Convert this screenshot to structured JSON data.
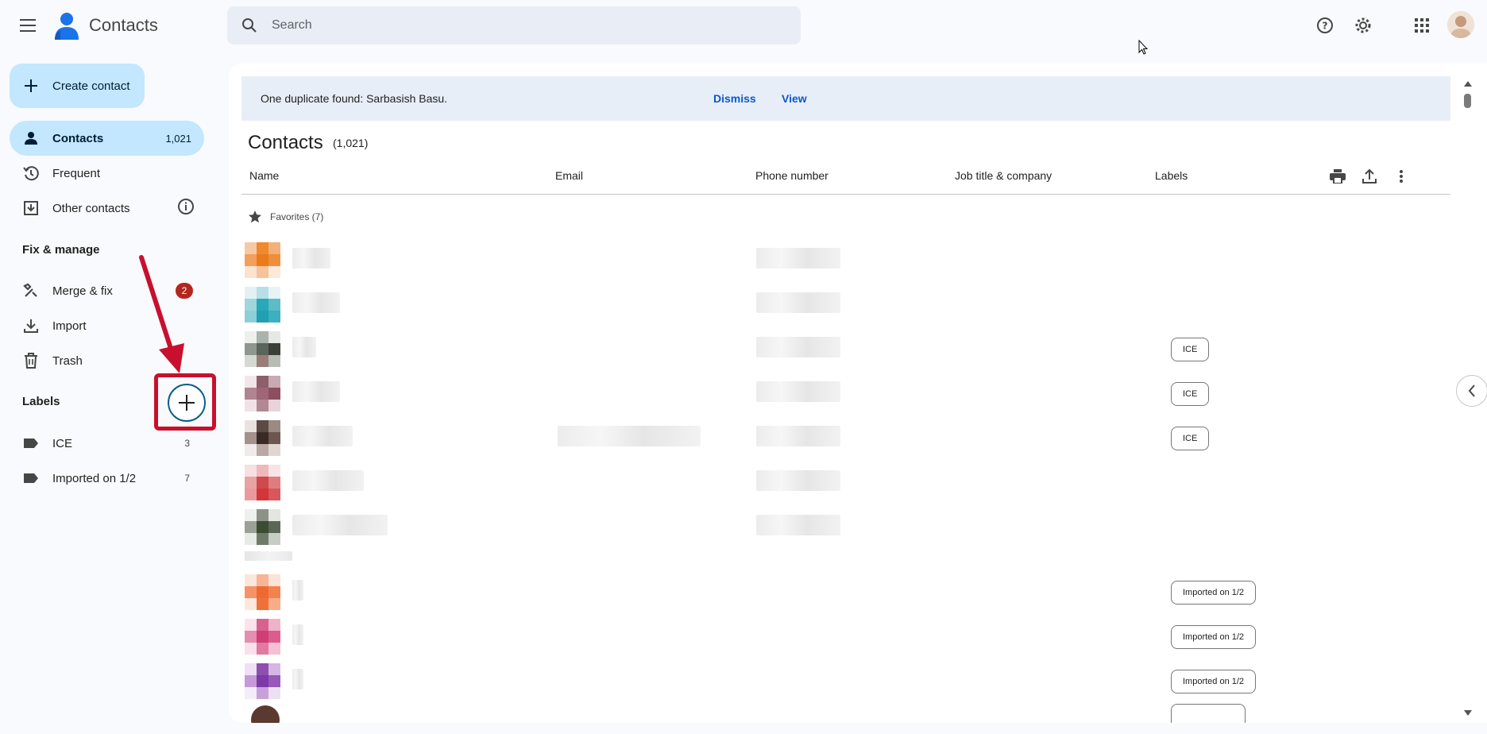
{
  "app": {
    "title": "Contacts"
  },
  "search": {
    "placeholder": "Search"
  },
  "sidebar": {
    "create_label": "Create contact",
    "contacts": {
      "label": "Contacts",
      "count": "1,021"
    },
    "frequent": {
      "label": "Frequent"
    },
    "other": {
      "label": "Other contacts"
    },
    "fix_manage_title": "Fix & manage",
    "merge": {
      "label": "Merge & fix",
      "badge": "2"
    },
    "import": {
      "label": "Import"
    },
    "trash": {
      "label": "Trash"
    },
    "labels_title": "Labels",
    "labels": [
      {
        "label": "ICE",
        "count": "3"
      },
      {
        "label": "Imported on 1/2",
        "count": "7"
      }
    ]
  },
  "banner": {
    "text": "One duplicate found: Sarbasish Basu.",
    "dismiss": "Dismiss",
    "view": "View"
  },
  "main": {
    "title": "Contacts",
    "count": "(1,021)",
    "columns": {
      "name": "Name",
      "email": "Email",
      "phone": "Phone number",
      "job": "Job title & company",
      "labels": "Labels"
    },
    "favorites": "Favorites (7)",
    "rows": [
      {
        "chip": ""
      },
      {
        "chip": ""
      },
      {
        "chip": "ICE"
      },
      {
        "chip": "ICE"
      },
      {
        "chip": "ICE"
      },
      {
        "chip": ""
      },
      {
        "chip": ""
      },
      {
        "chip": "Imported on 1/2"
      },
      {
        "chip": "Imported on 1/2"
      },
      {
        "chip": "Imported on 1/2"
      }
    ]
  },
  "colors": {
    "accent": "#c2e7ff",
    "link": "#0b57d0",
    "badge": "#b3261e",
    "highlight": "#c8102e"
  }
}
